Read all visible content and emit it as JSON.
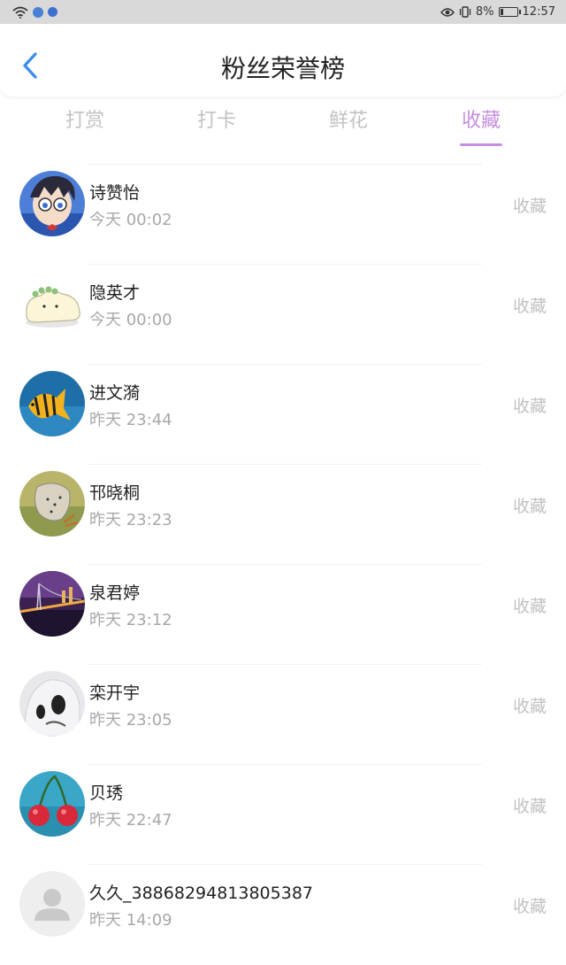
{
  "status_bar": {
    "time": "12:57",
    "battery_percent": "8%",
    "icons": [
      "wifi-icon",
      "app-notification-icon",
      "app-notification-icon",
      "eye-icon",
      "vibrate-icon",
      "battery-icon"
    ]
  },
  "header": {
    "title": "粉丝荣誉榜",
    "back_icon": "chevron-left-icon",
    "accent_color": "#3d8fe6"
  },
  "tabs": [
    {
      "label": "打赏",
      "active": false
    },
    {
      "label": "打卡",
      "active": false
    },
    {
      "label": "鲜花",
      "active": false
    },
    {
      "label": "收藏",
      "active": true
    }
  ],
  "active_tab_color": "#c58ee0",
  "fans": [
    {
      "name": "诗赞怡",
      "time": "今天 00:02",
      "action": "收藏",
      "avatar": "anime-boy-avatar"
    },
    {
      "name": "隐英才",
      "time": "今天 00:00",
      "action": "收藏",
      "avatar": "cartoon-creature-avatar"
    },
    {
      "name": "进文漪",
      "time": "昨天 23:44",
      "action": "收藏",
      "avatar": "fish-avatar"
    },
    {
      "name": "邗晓桐",
      "time": "昨天 23:23",
      "action": "收藏",
      "avatar": "butterfly-avatar"
    },
    {
      "name": "泉君婷",
      "time": "昨天 23:12",
      "action": "收藏",
      "avatar": "city-bridge-avatar"
    },
    {
      "name": "栾开宇",
      "time": "昨天 23:05",
      "action": "收藏",
      "avatar": "panda-hood-avatar"
    },
    {
      "name": "贝琇",
      "time": "昨天 22:47",
      "action": "收藏",
      "avatar": "cherries-avatar"
    },
    {
      "name": "久久_38868294813805387",
      "time": "昨天 14:09",
      "action": "收藏",
      "avatar": "default-user-avatar"
    }
  ]
}
